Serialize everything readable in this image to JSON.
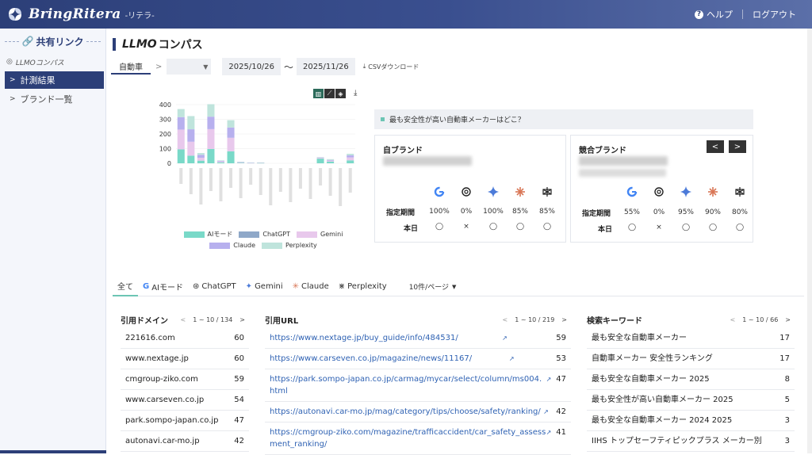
{
  "header": {
    "brand": "BringRitera",
    "brand_sub": "-リテラ-",
    "help": "ヘルプ",
    "logout": "ログアウト"
  },
  "sidebar": {
    "section": "共有リンク",
    "sub": "LLMOコンパス",
    "items": [
      {
        "label": "計測結果",
        "active": true
      },
      {
        "label": "ブランド一覧",
        "active": false
      }
    ]
  },
  "page": {
    "title_em": "LLMO",
    "title_rest": "コンパス"
  },
  "filters": {
    "category": "自動車",
    "date_from": "2025/10/26",
    "tilde": "〜",
    "date_to": "2025/11/26",
    "csv": "CSVダウンロード"
  },
  "chart_data": {
    "type": "bar",
    "stacked": true,
    "ylim": [
      0,
      400
    ],
    "yticks": [
      "400",
      "300",
      "200",
      "100",
      "0"
    ],
    "series": [
      {
        "name": "AIモード",
        "color": "#79d9c8",
        "values": [
          95,
          52,
          18,
          98,
          6,
          82,
          3,
          0,
          2,
          0,
          0,
          0,
          0,
          0,
          32,
          12,
          0,
          20
        ]
      },
      {
        "name": "ChatGPT",
        "color": "#8fa8c8",
        "values": [
          0,
          0,
          0,
          0,
          0,
          0,
          0,
          0,
          0,
          0,
          0,
          0,
          0,
          0,
          0,
          0,
          0,
          0
        ]
      },
      {
        "name": "Gemini",
        "color": "#e8c8ec",
        "values": [
          135,
          95,
          20,
          135,
          6,
          92,
          3,
          2,
          2,
          0,
          0,
          0,
          0,
          0,
          5,
          6,
          0,
          20
        ]
      },
      {
        "name": "Claude",
        "color": "#b7b0ee",
        "values": [
          85,
          85,
          20,
          85,
          5,
          70,
          2,
          1,
          1,
          0,
          0,
          0,
          0,
          0,
          3,
          5,
          0,
          15
        ]
      },
      {
        "name": "Perplexity",
        "color": "#bfe4dc",
        "values": [
          55,
          90,
          12,
          85,
          3,
          50,
          2,
          2,
          1,
          0,
          0,
          0,
          0,
          0,
          2,
          5,
          0,
          10
        ]
      }
    ]
  },
  "question": "最も安全性が高い自動車メーカーはどこ？",
  "own_brand": {
    "title": "自ブランド",
    "period_label": "指定期間",
    "today_label": "本日",
    "period": [
      "100%",
      "0%",
      "100%",
      "85%",
      "85%"
    ],
    "today": [
      "◯",
      "×",
      "◯",
      "◯",
      "◯"
    ]
  },
  "comp_brand": {
    "title": "競合ブランド",
    "prev": "<",
    "next": ">",
    "period_label": "指定期間",
    "today_label": "本日",
    "period": [
      "55%",
      "0%",
      "95%",
      "90%",
      "80%"
    ],
    "today": [
      "◯",
      "×",
      "◯",
      "◯",
      "◯"
    ]
  },
  "tabs": [
    {
      "label": "全て",
      "icon": ""
    },
    {
      "label": "AIモード",
      "icon": "google-icon"
    },
    {
      "label": "ChatGPT",
      "icon": "chatgpt-icon"
    },
    {
      "label": "Gemini",
      "icon": "gemini-icon"
    },
    {
      "label": "Claude",
      "icon": "claude-icon"
    },
    {
      "label": "Perplexity",
      "icon": "perplexity-icon"
    }
  ],
  "per_page": "10件/ページ",
  "domains": {
    "title": "引用ドメイン",
    "pager": "1 ~ 10 / 134",
    "rows": [
      {
        "name": "221616.com",
        "count": "60"
      },
      {
        "name": "www.nextage.jp",
        "count": "60"
      },
      {
        "name": "cmgroup-ziko.com",
        "count": "59"
      },
      {
        "name": "www.carseven.co.jp",
        "count": "54"
      },
      {
        "name": "park.sompo-japan.co.jp",
        "count": "47"
      },
      {
        "name": "autonavi.car-mo.jp",
        "count": "42"
      }
    ]
  },
  "urls": {
    "title": "引用URL",
    "pager": "1 ~ 10 / 219",
    "rows": [
      {
        "url": "https://www.nextage.jp/buy_guide/info/484531/",
        "count": "59"
      },
      {
        "url": "https://www.carseven.co.jp/magazine/news/11167/",
        "count": "53"
      },
      {
        "url": "https://park.sompo-japan.co.jp/carmag/mycar/select/column/ms004.html",
        "count": "47"
      },
      {
        "url": "https://autonavi.car-mo.jp/mag/category/tips/choose/safety/ranking/",
        "count": "42"
      },
      {
        "url": "https://cmgroup-ziko.com/magazine/trafficaccident/car_safety_assessment_ranking/",
        "count": "41"
      }
    ]
  },
  "keywords": {
    "title": "検索キーワード",
    "pager": "1 ~ 10 / 66",
    "rows": [
      {
        "kw": "最も安全な自動車メーカー",
        "count": "17"
      },
      {
        "kw": "自動車メーカー 安全性ランキング",
        "count": "17"
      },
      {
        "kw": "最も安全な自動車メーカー 2025",
        "count": "8"
      },
      {
        "kw": "最も安全性が高い自動車メーカー 2025",
        "count": "5"
      },
      {
        "kw": "最も安全な自動車メーカー 2024 2025",
        "count": "3"
      },
      {
        "kw": "IIHS トップセーフティピックプラス メーカー別",
        "count": "3"
      }
    ]
  }
}
